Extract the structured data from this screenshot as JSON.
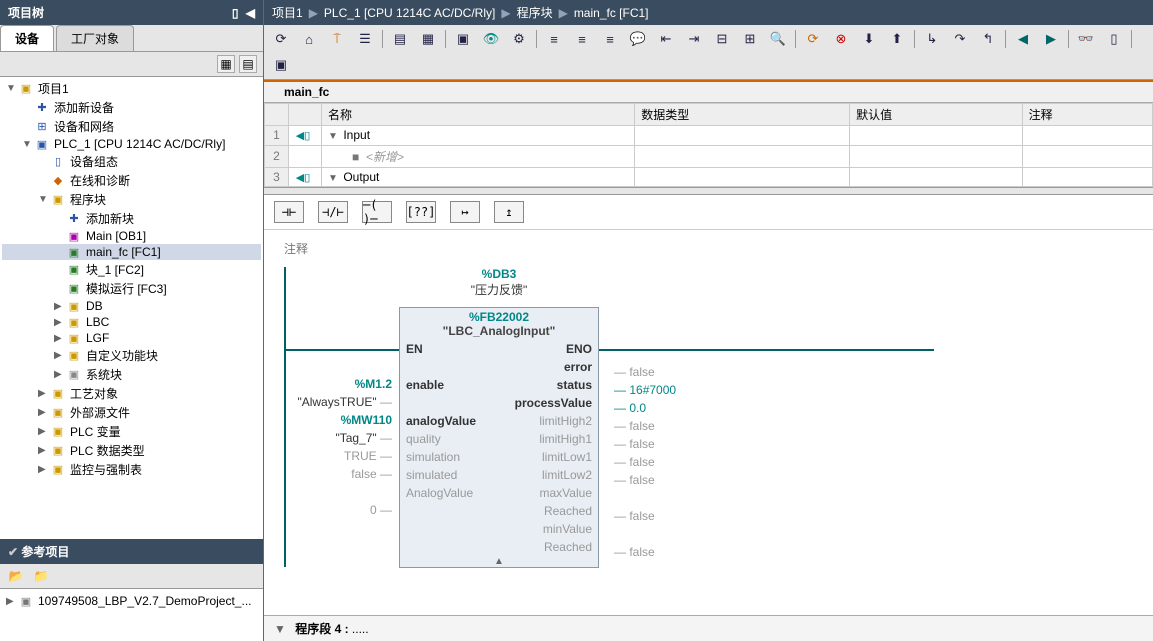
{
  "left": {
    "title": "项目树",
    "tab1": "设备",
    "tab2": "工厂对象",
    "tree": {
      "project": "项目1",
      "add_device": "添加新设备",
      "dev_net": "设备和网络",
      "plc": "PLC_1 [CPU 1214C AC/DC/Rly]",
      "dev_config": "设备组态",
      "online_diag": "在线和诊断",
      "prog_blocks": "程序块",
      "add_block": "添加新块",
      "main_ob": "Main [OB1]",
      "main_fc": "main_fc [FC1]",
      "blk1": "块_1 [FC2]",
      "simrun": "模拟运行 [FC3]",
      "db": "DB",
      "lbc": "LBC",
      "lgf": "LGF",
      "custom_fb": "自定义功能块",
      "sys_blk": "系统块",
      "tech_obj": "工艺对象",
      "ext_src": "外部源文件",
      "plc_var": "PLC 变量",
      "plc_dt": "PLC 数据类型",
      "watch": "监控与强制表"
    },
    "ref_title": "参考项目",
    "ref_project": "109749508_LBP_V2.7_DemoProject_..."
  },
  "breadcrumb": {
    "b1": "项目1",
    "b2": "PLC_1 [CPU 1214C AC/DC/Rly]",
    "b3": "程序块",
    "b4": "main_fc [FC1]"
  },
  "fc": {
    "title": "main_fc",
    "col_name": "名称",
    "col_dtype": "数据类型",
    "col_default": "默认值",
    "col_comment": "注释",
    "row_input": "Input",
    "row_add": "<新增>",
    "row_output": "Output"
  },
  "lad": {
    "comment": "注释",
    "db_addr": "%DB3",
    "db_name": "\"压力反馈\"",
    "fb_addr": "%FB22002",
    "fb_name": "\"LBC_AnalogInput\"",
    "en": "EN",
    "eno": "ENO",
    "in1_addr": "%M1.2",
    "in1_name": "\"AlwaysTRUE\"",
    "in1_pin": "enable",
    "in2_addr": "%MW110",
    "in2_name": "\"Tag_7\"",
    "in2_pin": "analogValue",
    "in3_val": "TRUE",
    "in3_pin": "quality",
    "in4_val": "false",
    "in4_pin": "simulation",
    "in5_pin": "simulated",
    "in5b_pin": "AnalogValue",
    "in5_val": "0",
    "out1_pin": "error",
    "out1_val": "false",
    "out2_pin": "status",
    "out2_val": "16#7000",
    "out3_pin": "processValue",
    "out3_val": "0.0",
    "out4_pin": "limitHigh2",
    "out4_val": "false",
    "out5_pin": "limitHigh1",
    "out5_val": "false",
    "out6_pin": "limitLow1",
    "out6_val": "false",
    "out7_pin": "limitLow2",
    "out7_val": "false",
    "out8a_pin": "maxValue",
    "out8b_pin": "Reached",
    "out8_val": "false",
    "out9a_pin": "minValue",
    "out9b_pin": "Reached",
    "out9_val": "false",
    "segment": "程序段 4 :",
    "segment_dots": "....."
  }
}
